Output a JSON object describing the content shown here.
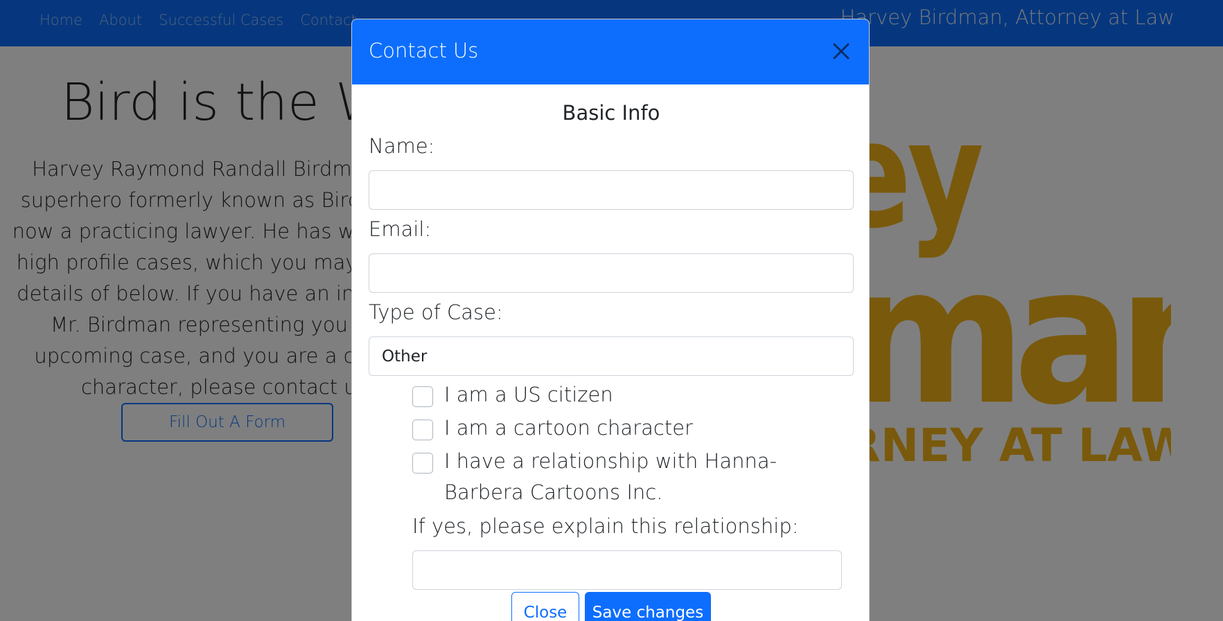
{
  "nav": {
    "links": [
      "Home",
      "About",
      "Successful Cases",
      "Contact"
    ],
    "brand": "Harvey Birdman, Attorney at Law"
  },
  "hero": {
    "title": "Bird is the Word",
    "text": "Harvey Raymond Randall Birdman, the superhero formerly known as Birdman, is now a practicing lawyer. He has won many high profile cases, which you may see the details of below. If you have an interest in Mr. Birdman representing you in an upcoming case, and you are a cartoon character, please contact us.",
    "button": "Fill Out A Form"
  },
  "logo": {
    "line1": "ey",
    "line2": "man",
    "line3": "RNEY AT LAW"
  },
  "modal": {
    "title": "Contact Us",
    "section": "Basic Info",
    "name_label": "Name:",
    "email_label": "Email:",
    "case_label": "Type of Case:",
    "case_value": "Other",
    "checks": [
      "I am a US citizen",
      "I am a cartoon character",
      "I have a relationship with Hanna-Barbera Cartoons Inc."
    ],
    "explain_label": "If yes, please explain this relationship:",
    "close_button": "Close",
    "save_button": "Save changes"
  },
  "colors": {
    "primary": "#0d6efd",
    "logo": "#f3b318"
  }
}
